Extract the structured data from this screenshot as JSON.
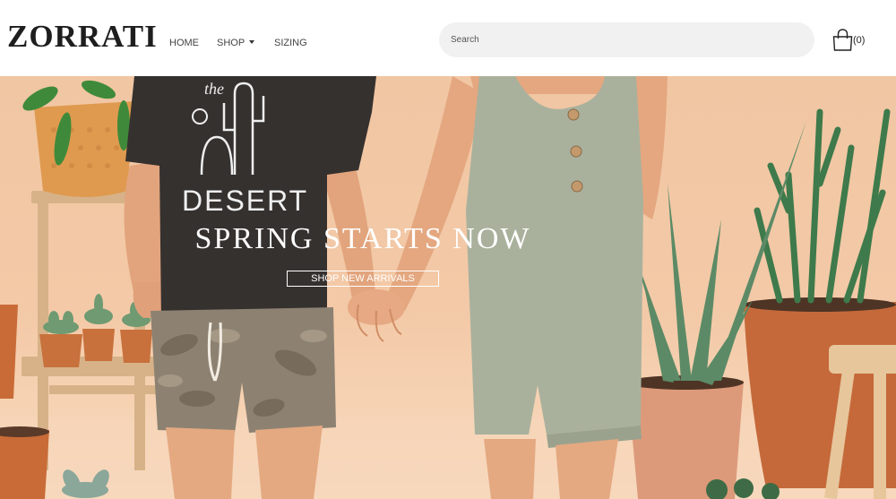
{
  "brand": {
    "logo_text": "ZORRATI"
  },
  "nav": {
    "items": [
      {
        "label": "HOME"
      },
      {
        "label": "SHOP",
        "has_dropdown": true
      },
      {
        "label": "SIZING"
      }
    ]
  },
  "search": {
    "placeholder": "Search",
    "value": ""
  },
  "cart": {
    "icon": "shopping-bag-icon",
    "count_label": "(0)"
  },
  "hero": {
    "title": "SPRING STARTS NOW",
    "cta_label": "SHOP NEW ARRIVALS",
    "shirt_text_top": "the",
    "shirt_text_bottom": "DESERT"
  },
  "colors": {
    "background_wall": "#f3c9a7",
    "text_dark": "#1e1e1e",
    "nav_text": "#444444",
    "search_bg": "#f1f1f1",
    "hero_text": "#ffffff",
    "shirt": "#35312f",
    "romper": "#a9b19d",
    "pot": "#cf7845"
  }
}
